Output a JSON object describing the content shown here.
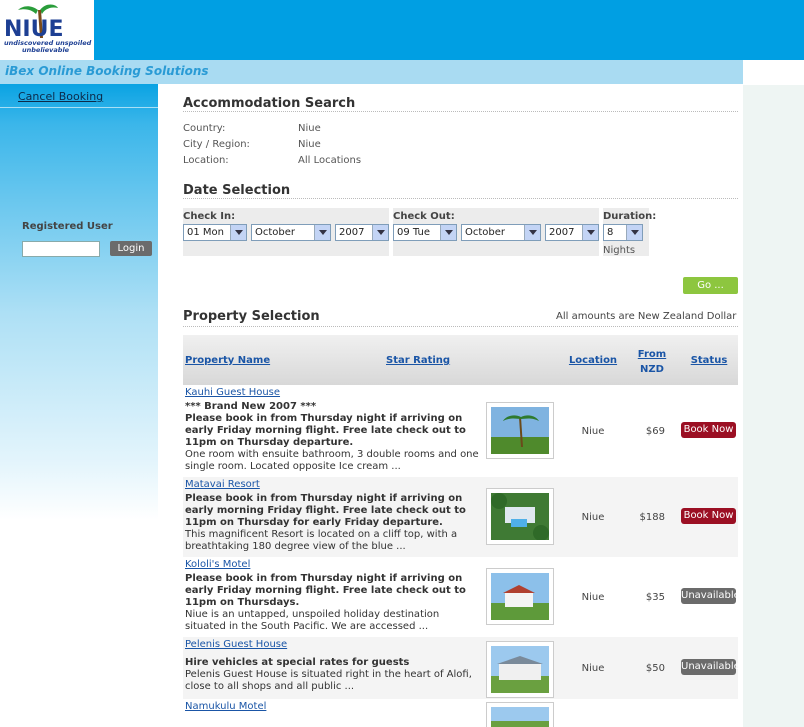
{
  "brand": {
    "logo_text": "NIUE",
    "logo_tagline_1": "undiscovered unspoiled",
    "logo_tagline_2": "unbelievable",
    "product_title": "iBex Online Booking Solutions"
  },
  "sidebar": {
    "cancel_label": "Cancel Booking",
    "registered_user_label": "Registered User",
    "login_label": "Login",
    "login_value": ""
  },
  "accommodation": {
    "title": "Accommodation Search",
    "fields": [
      {
        "label": "Country:",
        "value": "Niue"
      },
      {
        "label": "City / Region:",
        "value": "Niue"
      },
      {
        "label": "Location:",
        "value": "All Locations"
      }
    ]
  },
  "dates": {
    "title": "Date Selection",
    "checkin_label": "Check In:",
    "checkin_day": "01 Mon",
    "checkin_month": "October",
    "checkin_year": "2007",
    "checkout_label": "Check Out:",
    "checkout_day": "09 Tue",
    "checkout_month": "October",
    "checkout_year": "2007",
    "duration_label": "Duration:",
    "duration_value": "8",
    "nights_label": "Nights",
    "go_label": "Go ..."
  },
  "properties": {
    "title": "Property Selection",
    "currency_note": "All amounts are New Zealand Dollar",
    "headers": {
      "name": "Property Name",
      "stars": "Star Rating",
      "location": "Location",
      "from_1": "From",
      "from_2": "NZD",
      "status": "Status"
    },
    "rows": [
      {
        "name": "Kauhi Guest House",
        "line1": "*** Brand New 2007 ***",
        "bold": "Please book in from Thursday night if arriving on early Friday morning flight. Free late check out to 11pm on Thursday departure.",
        "desc": "One room with ensuite bathroom, 3 double rooms and one single room. Located opposite Ice cream ...",
        "location": "Niue",
        "price": "$69",
        "status": "Book Now"
      },
      {
        "name": "Matavai Resort",
        "line1": "",
        "bold": "Please book in from Thursday night if arriving on early morning Friday flight. Free late check out to 11pm on Thursday for early Friday departure.",
        "desc": "This magnificent Resort is located on a cliff top, with a breathtaking 180 degree view of the blue ...",
        "location": "Niue",
        "price": "$188",
        "status": "Book Now"
      },
      {
        "name": "Kololi's Motel",
        "line1": "",
        "bold": "Please book in from Thursday night if arriving on early Friday morning flight. Free late check out to 11pm on Thursdays.",
        "desc": "Niue is an untapped, unspoiled holiday destination situated in the South Pacific. We are accessed ...",
        "location": "Niue",
        "price": "$35",
        "status": "Unavailable"
      },
      {
        "name": "Pelenis Guest House",
        "line1": "",
        "bold": "Hire vehicles at special rates for guests",
        "desc": "Pelenis Guest House is situated right in the heart of Alofi, close to all shops and all public ...",
        "location": "Niue",
        "price": "$50",
        "status": "Unavailable"
      },
      {
        "name": "Namukulu Motel",
        "line1": "",
        "bold": "",
        "desc": "",
        "location": "",
        "price": "",
        "status": ""
      }
    ]
  },
  "colors": {
    "header_blue": "#009fe3",
    "book_now": "#9b0f23",
    "unavailable": "#6b6b6b",
    "go_green": "#8dc63f",
    "link_blue": "#1a55a6"
  }
}
